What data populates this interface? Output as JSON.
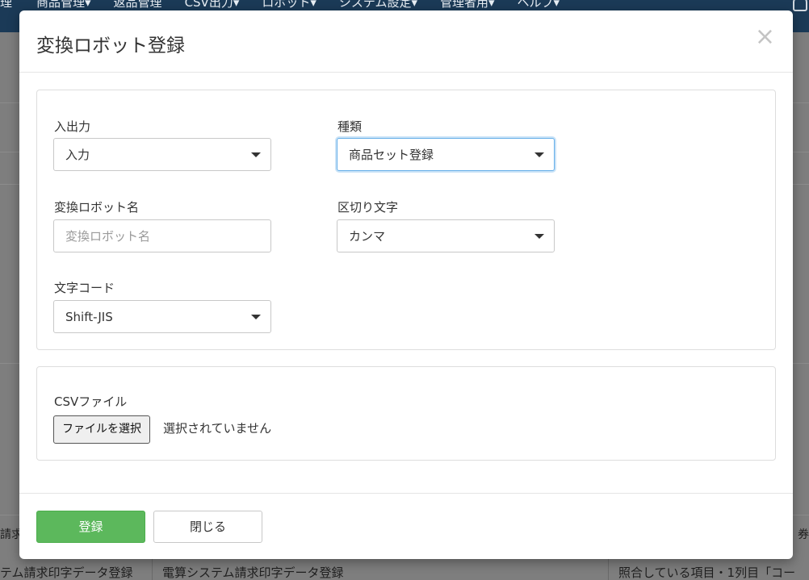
{
  "background": {
    "nav_items": [
      "理",
      "商品管理▾",
      "返品管理",
      "CSV出力▾",
      "ロボット▾",
      "システム設定▾",
      "管理者用▾",
      "ヘルプ▾"
    ],
    "left_fragment": "請求",
    "right_fragment": "、券",
    "bottom_row": [
      "テム請求印字データ登録",
      "電算システム請求印字データ登録",
      "照合している項目・1列目「コー"
    ]
  },
  "modal": {
    "title": "変換ロボット登録",
    "close_symbol": "×",
    "fields": {
      "io": {
        "label": "入出力",
        "value": "入力"
      },
      "type": {
        "label": "種類",
        "value": "商品セット登録"
      },
      "robot_name": {
        "label": "変換ロボット名",
        "placeholder": "変換ロボット名",
        "value": ""
      },
      "delimiter": {
        "label": "区切り文字",
        "value": "カンマ"
      },
      "encoding": {
        "label": "文字コード",
        "value": "Shift-JIS"
      }
    },
    "csv": {
      "label": "CSVファイル",
      "button_label": "ファイルを選択",
      "status": "選択されていません"
    },
    "footer": {
      "submit_label": "登録",
      "close_label": "閉じる"
    }
  },
  "colors": {
    "nav_bg": "#1b3a57",
    "primary": "#5cb85c",
    "focus": "#66afe9"
  }
}
